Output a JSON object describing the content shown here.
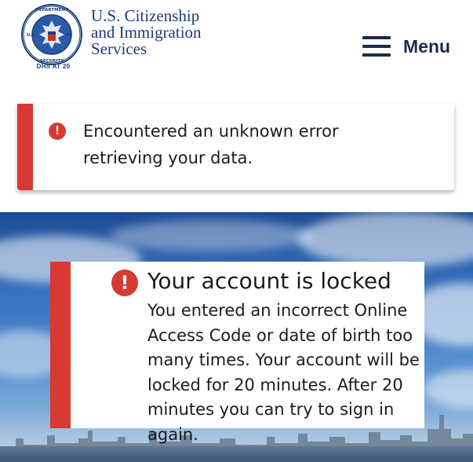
{
  "header": {
    "agency_name_lines": [
      "U.S. Citizenship",
      "and Immigration",
      "Services"
    ],
    "seal_caption": "DHS AT 20",
    "seal_text": "U.S. DEPARTMENT OF HOMELAND SECURITY",
    "menu_label": "Menu"
  },
  "error_alert": {
    "icon": "exclamation-circle-icon",
    "message": "Encountered an unknown error retrieving your data."
  },
  "locked_alert": {
    "icon": "exclamation-circle-icon",
    "title": "Your account is locked",
    "body": "You entered an incorrect Online Access Code or date of birth too many times. Your account will be locked for 20 minutes. After 20 minutes you can try to sign in again."
  },
  "colors": {
    "brand_blue": "#1a3d7a",
    "alert_red": "#d83933",
    "text": "#1b1b1b"
  }
}
